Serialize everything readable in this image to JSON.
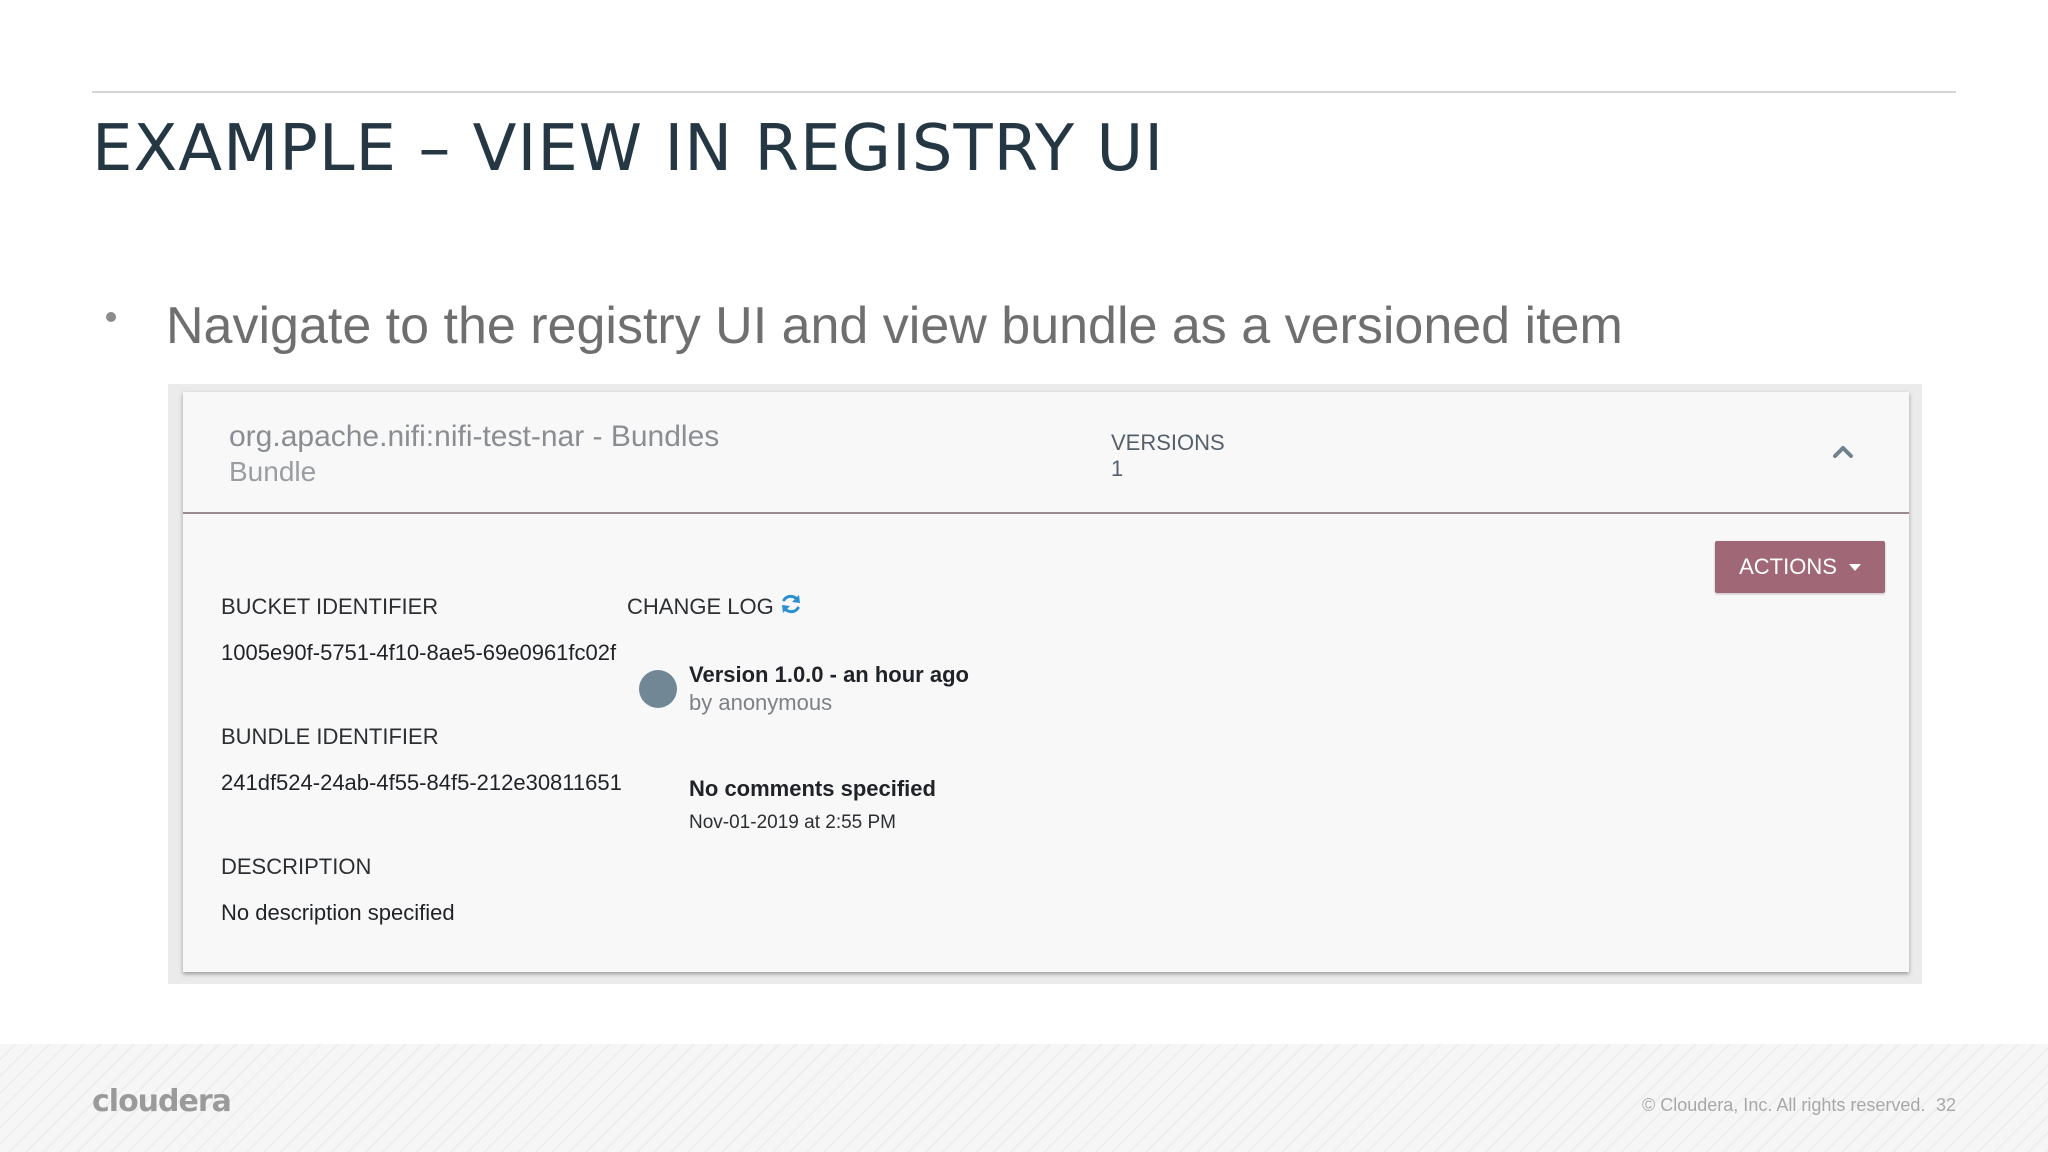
{
  "slide": {
    "title": "EXAMPLE – VIEW IN REGISTRY UI",
    "bullet": "Navigate to the registry UI and view bundle as a versioned item"
  },
  "registry": {
    "item": {
      "name": "org.apache.nifi:nifi-test-nar - Bundles",
      "type": "Bundle",
      "versions_label": "VERSIONS",
      "versions_count": "1"
    },
    "actions_label": "ACTIONS",
    "fields": {
      "bucket_label": "BUCKET IDENTIFIER",
      "bucket_value": "1005e90f-5751-4f10-8ae5-69e0961fc02f",
      "bundle_label": "BUNDLE IDENTIFIER",
      "bundle_value": "241df524-24ab-4f55-84f5-212e30811651",
      "description_label": "DESCRIPTION",
      "description_value": "No description specified"
    },
    "changelog": {
      "label": "CHANGE LOG",
      "entries": [
        {
          "title": "Version 1.0.0 - an hour ago",
          "author": "by anonymous",
          "comments": "No comments specified",
          "timestamp": "Nov-01-2019 at 2:55 PM"
        }
      ]
    }
  },
  "footer": {
    "logo": "cloudera",
    "copyright": "© Cloudera, Inc. All rights reserved.",
    "page_number": "32"
  },
  "colors": {
    "title": "#243743",
    "actions_button": "#a06877",
    "refresh_icon": "#2b8fd1",
    "timeline_dot": "#728795"
  },
  "icons": {
    "collapse": "chevron-up-icon",
    "refresh": "refresh-icon",
    "actions_caret": "caret-down-icon",
    "bullet": "bullet-dot-icon"
  }
}
